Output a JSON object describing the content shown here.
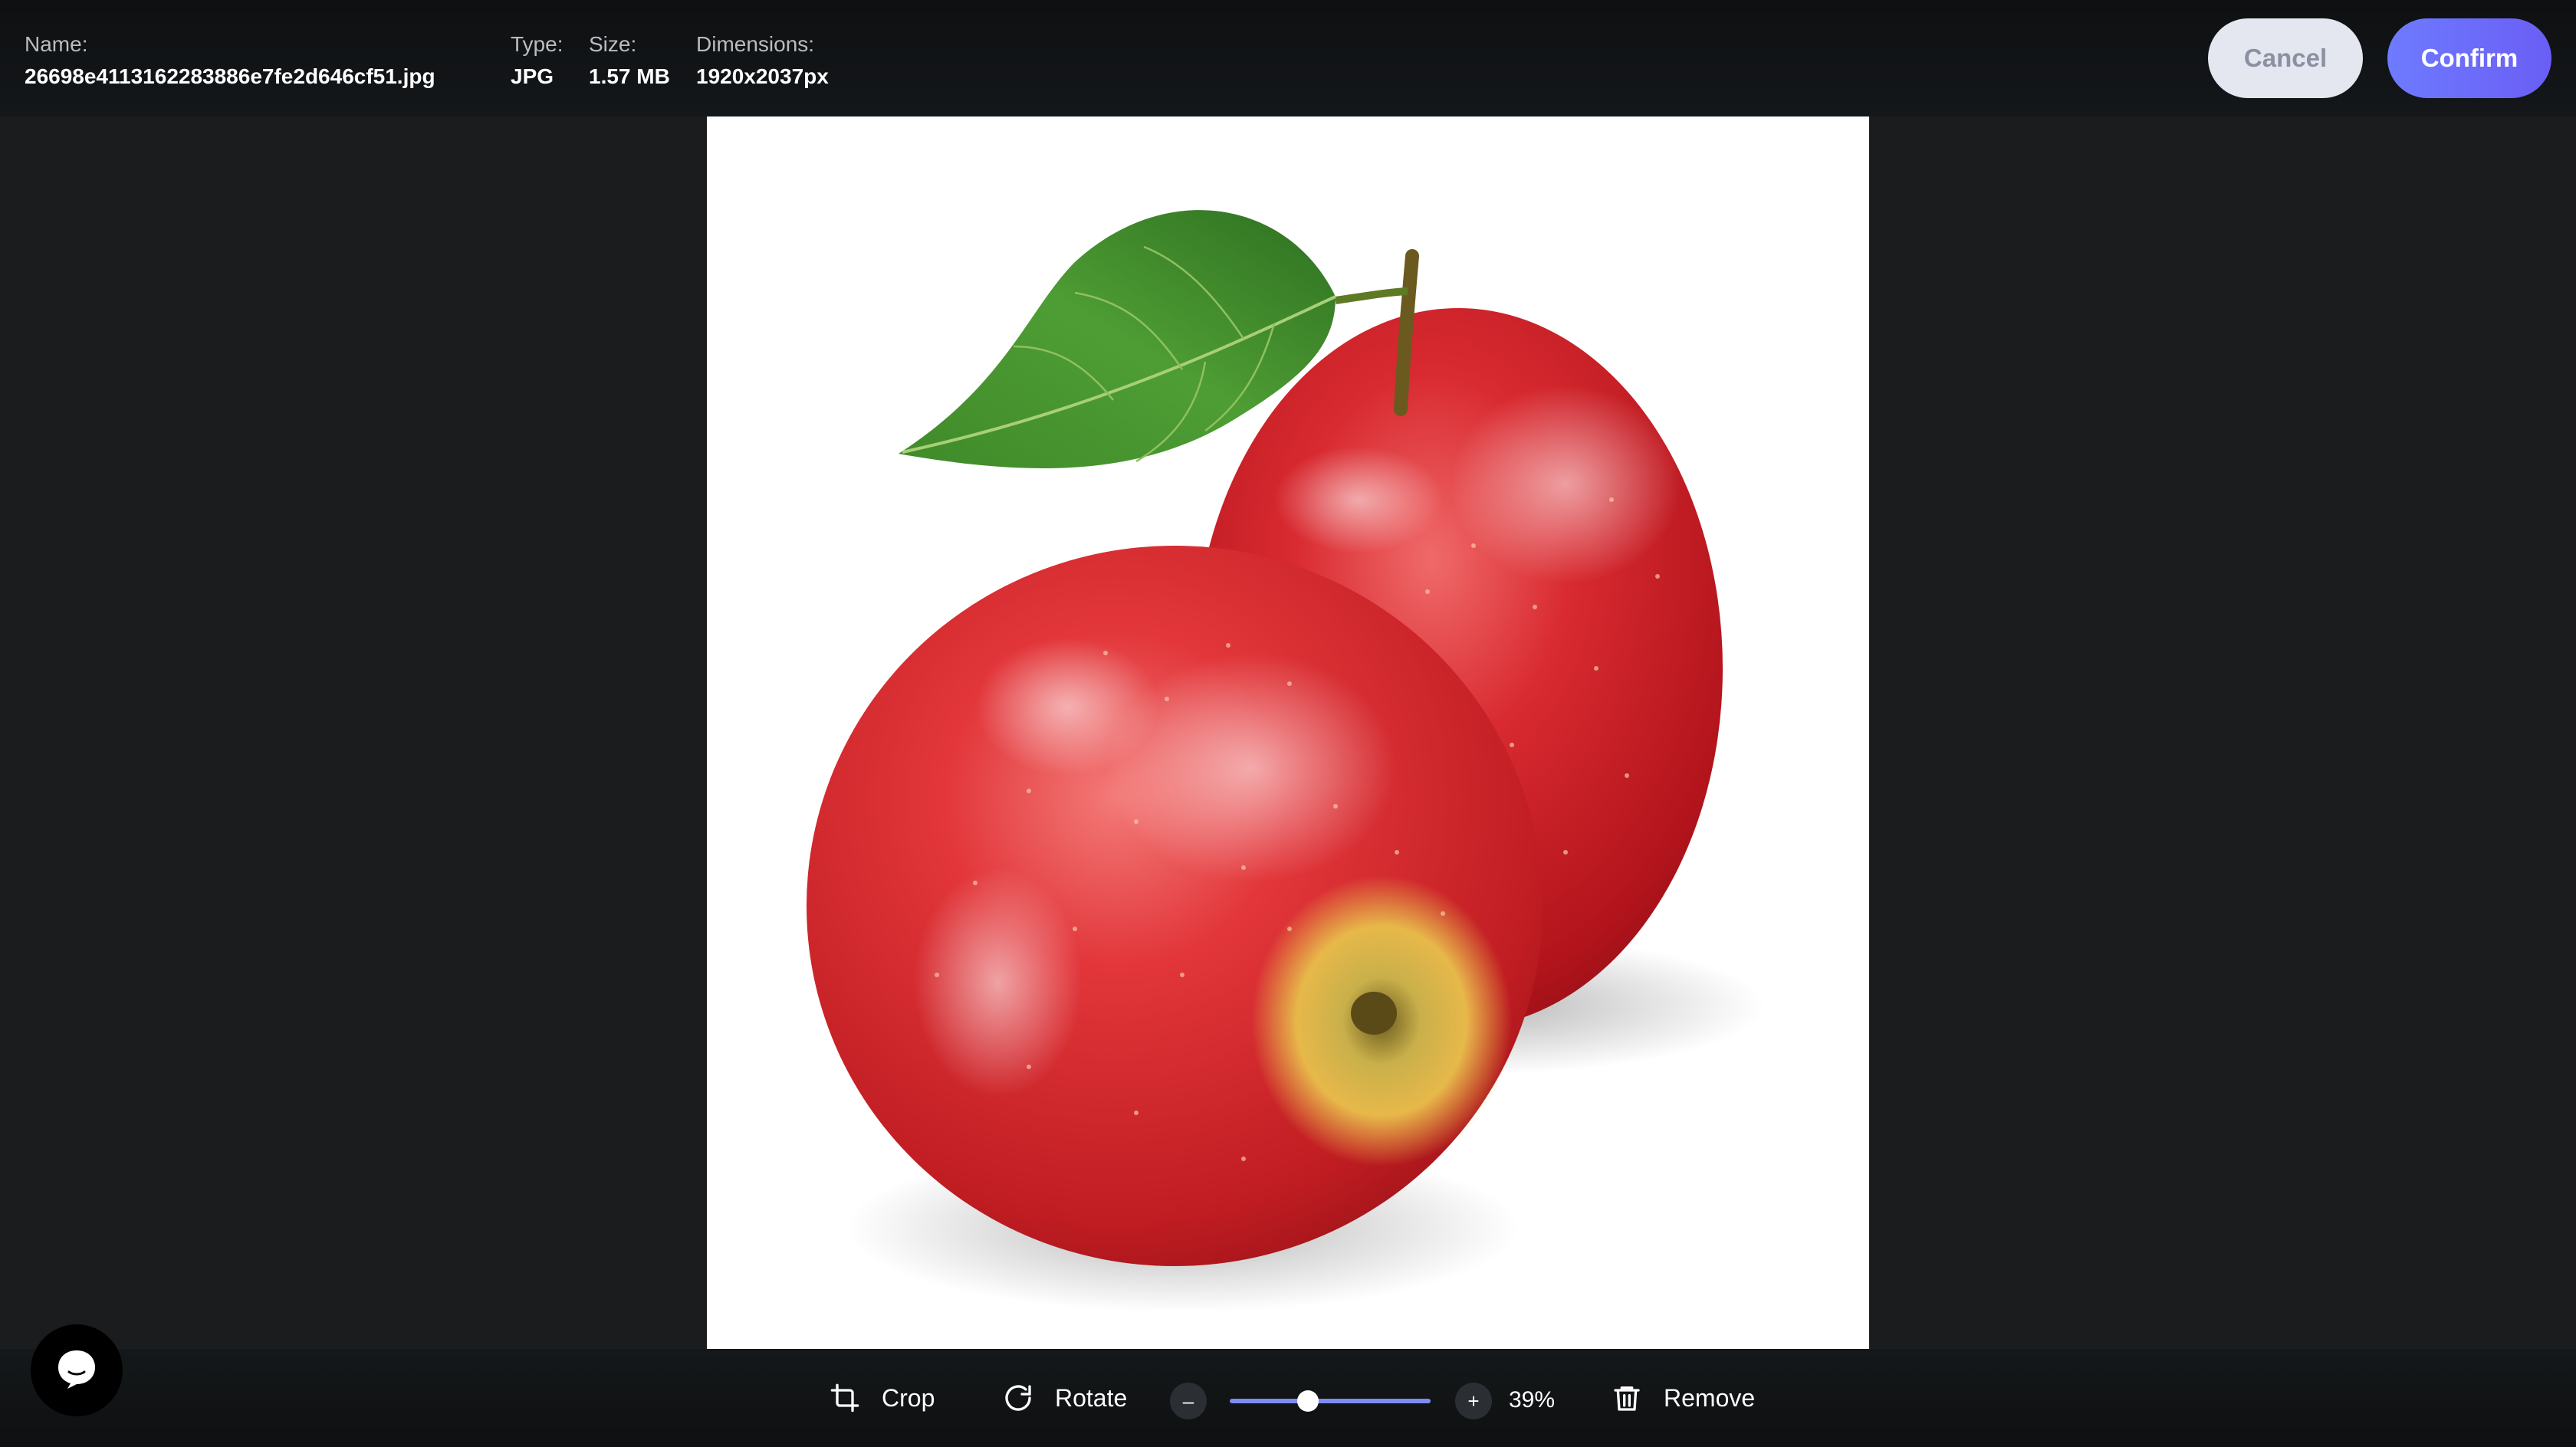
{
  "file": {
    "name_label": "Name:",
    "name": "26698e4113162283886e7fe2d646cf51.jpg",
    "type_label": "Type:",
    "type": "JPG",
    "size_label": "Size:",
    "size": "1.57 MB",
    "dimensions_label": "Dimensions:",
    "dimensions": "1920x2037px"
  },
  "actions": {
    "cancel_label": "Cancel",
    "confirm_label": "Confirm"
  },
  "toolbar": {
    "crop_label": "Crop",
    "rotate_label": "Rotate",
    "zoom_out_label": "–",
    "zoom_in_label": "+",
    "zoom_value": "39%",
    "zoom_level": 0.39,
    "remove_label": "Remove"
  },
  "colors": {
    "confirm_accent": "#6a6ef8",
    "cancel_bg": "#e4e7ef",
    "background": "#1a1c1e"
  },
  "icons": {
    "crop": "crop-icon",
    "rotate": "rotate-icon",
    "remove": "trash-icon",
    "chat": "chat-bubble-icon"
  }
}
